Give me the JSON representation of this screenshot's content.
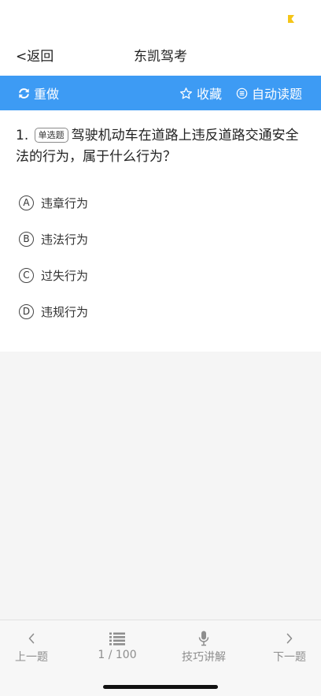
{
  "header": {
    "back_label": "<返回",
    "title": "东凯驾考"
  },
  "toolbar": {
    "redo_label": "重做",
    "favorite_label": "收藏",
    "auto_read_label": "自动读题"
  },
  "question": {
    "number": "1.",
    "type_badge": "单选题",
    "text": "驾驶机动车在道路上违反道路交通安全法的行为，属于什么行为？",
    "options": [
      {
        "letter": "A",
        "text": "违章行为"
      },
      {
        "letter": "B",
        "text": "违法行为"
      },
      {
        "letter": "C",
        "text": "过失行为"
      },
      {
        "letter": "D",
        "text": "违规行为"
      }
    ]
  },
  "bottom_nav": {
    "prev_label": "上一题",
    "progress_label": "1 / 100",
    "tips_label": "技巧讲解",
    "next_label": "下一题"
  },
  "colors": {
    "accent": "#3d9bf4",
    "status_mark": "#f5c518",
    "nav_text": "#8e8e8e"
  },
  "icons": {
    "redo": "refresh-icon",
    "favorite": "star-outline-icon",
    "auto_read": "list-circle-icon",
    "prev": "chevron-left-icon",
    "list": "list-icon",
    "tips": "microphone-icon",
    "next": "chevron-right-icon"
  }
}
